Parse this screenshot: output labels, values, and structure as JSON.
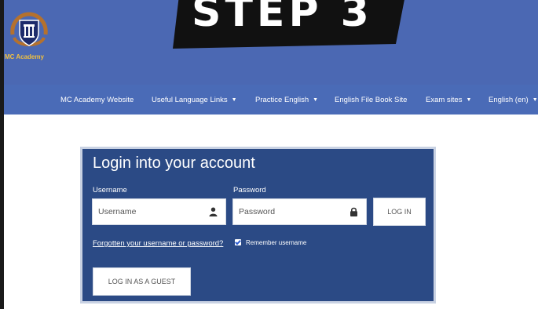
{
  "banner": {
    "text": "STEP 3"
  },
  "brand": {
    "name": "MC Academy"
  },
  "nav": {
    "items": [
      {
        "label": "MC Academy Website",
        "has_caret": false
      },
      {
        "label": "Useful Language Links",
        "has_caret": true
      },
      {
        "label": "Practice English",
        "has_caret": true
      },
      {
        "label": "English File Book Site",
        "has_caret": false
      },
      {
        "label": "Exam sites",
        "has_caret": true
      },
      {
        "label": "English (en)",
        "has_caret": true
      }
    ],
    "caret": "▼"
  },
  "login": {
    "title": "Login into your account",
    "username_label": "Username",
    "username_placeholder": "Username",
    "password_label": "Password",
    "password_placeholder": "Password",
    "login_button": "LOG IN",
    "forgot_link": "Forgotten your username or password?",
    "remember_label": "Remember username",
    "remember_checked": true,
    "guest_button": "LOG IN AS A GUEST"
  },
  "colors": {
    "header": "#4a6bb7",
    "panel": "#2b4a85",
    "banner": "#111111"
  },
  "icons": {
    "user": "user-icon",
    "lock": "lock-icon"
  }
}
